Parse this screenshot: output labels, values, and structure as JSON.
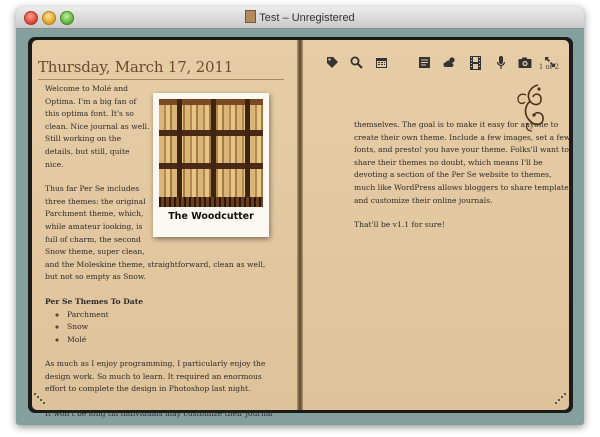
{
  "window": {
    "title": "Test – Unregistered"
  },
  "left_page": {
    "date": "Thursday, March 17, 2011",
    "page_indicator": "1 of 2",
    "p1": [
      "Welcome to Molé and",
      "Optima. I'm a big fan of",
      "this optima font. It's so",
      "clean. Nice journal as well.",
      "Still working on the",
      "details, but still, quite",
      "nice."
    ],
    "p2_wrapped": [
      "Thus far Per Se includes",
      "three themes: the original",
      "Parchment theme, which,",
      "while amateur looking, is",
      "full of charm, the second",
      "Snow theme, super clean,"
    ],
    "p2_rest": "and the Moleskine theme, straightforward, clean as well, but not so empty as Snow.",
    "list_heading": "Per Se Themes To Date",
    "themes": [
      "Parchment",
      "Snow",
      "Molé"
    ],
    "p3": "As much as I enjoy programming, I particularly enjoy the design work. So much to learn. It required an enormous effort to complete the design in Photoshop last night.",
    "p4": "It won't be long till individuals may customize their journal",
    "photo_caption": "The Woodcutter"
  },
  "right_page": {
    "p1": "themselves. The goal is to make it easy for anyone to create their own theme. Include a few images, set a few fonts, and presto! you have your theme. Folks'll want to share their themes no doubt, which means I'll be devoting a section of the Per Se website to themes, much like WordPress allows bloggers to share templates and customize their online journals.",
    "p2": "That'll be v1.1 for sure!"
  },
  "toolbar": {
    "icons": [
      "tag-icon",
      "search-icon",
      "calendar-icon",
      "notes-icon",
      "weather-icon",
      "film-icon",
      "microphone-icon",
      "camera-icon",
      "fullscreen-icon"
    ]
  },
  "colors": {
    "page": "#e4caa3",
    "book_cover": "#1b1b1b",
    "window_bg": "#84a09c",
    "date_text": "#6b4a2c"
  }
}
